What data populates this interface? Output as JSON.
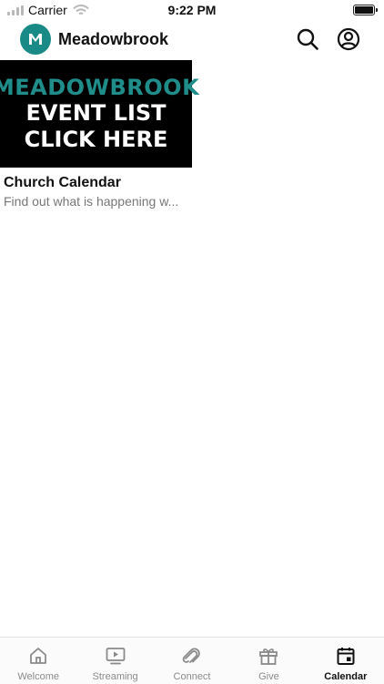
{
  "status_bar": {
    "carrier": "Carrier",
    "time": "9:22 PM"
  },
  "header": {
    "title": "Meadowbrook",
    "logo_letter": "M",
    "accent": "#1a8a87"
  },
  "card": {
    "banner_lines": [
      "MEADOWBROOK",
      "EVENT LIST",
      "CLICK HERE"
    ],
    "title": "Church Calendar",
    "subtitle": "Find out what is happening w..."
  },
  "tabs": [
    {
      "label": "Welcome",
      "icon": "home-icon"
    },
    {
      "label": "Streaming",
      "icon": "tv-play-icon"
    },
    {
      "label": "Connect",
      "icon": "connect-icon"
    },
    {
      "label": "Give",
      "icon": "gift-icon"
    },
    {
      "label": "Calendar",
      "icon": "calendar-icon",
      "active": true
    }
  ]
}
